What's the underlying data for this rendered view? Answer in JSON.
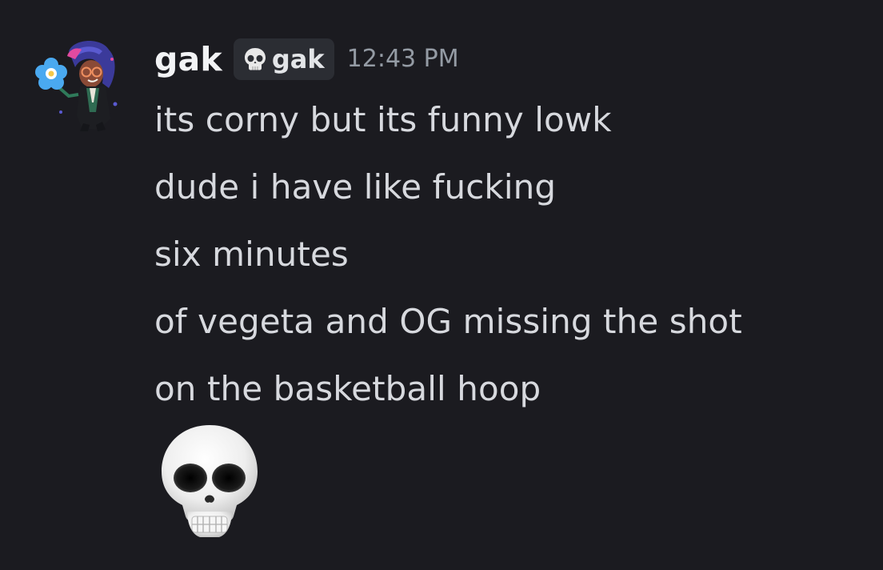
{
  "message": {
    "author": {
      "name": "gak",
      "avatar_icon": "character-avatar-icon"
    },
    "clan_tag": {
      "icon": "skull-icon",
      "label": "gak"
    },
    "timestamp": "12:43 PM",
    "lines": [
      "its corny but its funny lowk",
      "dude i have like fucking",
      "six minutes",
      "of vegeta and OG missing the shot",
      "on the basketball hoop"
    ],
    "emoji": "skull-emoji"
  },
  "colors": {
    "background": "#1b1b20",
    "username": "#f2f3f5",
    "message_text": "#d7d9de",
    "timestamp": "#949ba4",
    "tag_background": "#2b2d33"
  }
}
